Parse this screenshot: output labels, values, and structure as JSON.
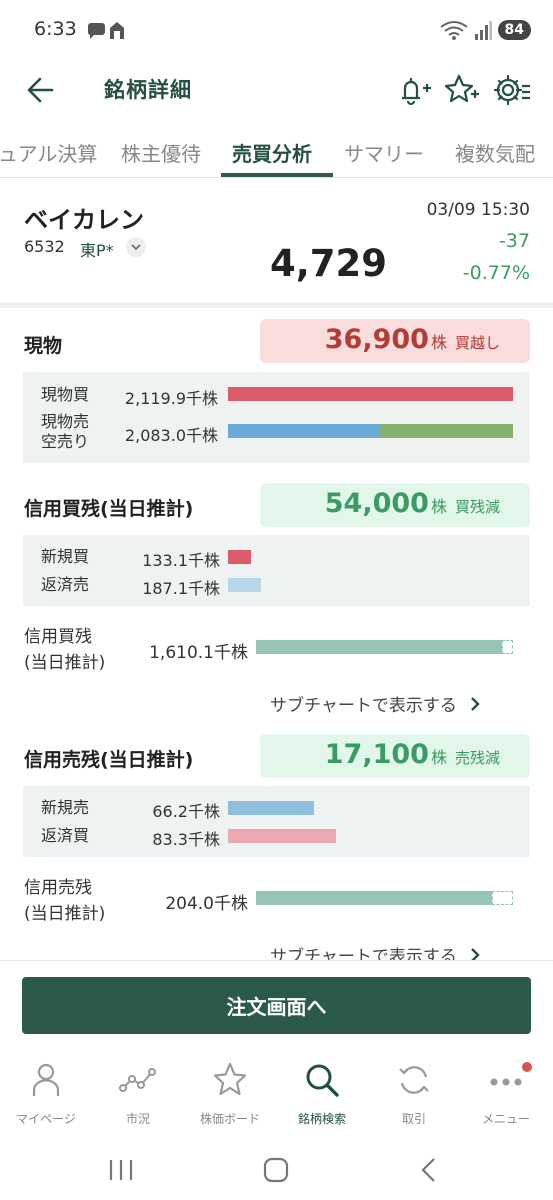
{
  "status": {
    "time": "6:33",
    "battery": "84"
  },
  "appbar": {
    "title": "銘柄詳細"
  },
  "tabs": [
    {
      "label": "ュアル決算"
    },
    {
      "label": "株主優待"
    },
    {
      "label": "売買分析"
    },
    {
      "label": "サマリー"
    },
    {
      "label": "複数気配"
    }
  ],
  "stock": {
    "name": "ベイカレン",
    "code": "6532",
    "market": "東P*",
    "price": "4,729",
    "datetime": "03/09 15:30",
    "change": "-37",
    "change_pct": "-0.77%"
  },
  "genbutsu": {
    "title": "現物",
    "pill_value": "36,900",
    "pill_unit": "株",
    "pill_label": "買越し",
    "buy_label": "現物買",
    "buy_value": "2,119.9千株",
    "sell_label_1": "現物売",
    "sell_label_2": "空売り",
    "sell_value": "2,083.0千株"
  },
  "margin_buy": {
    "title": "信用買残(当日推計)",
    "pill_value": "54,000",
    "pill_unit": "株",
    "pill_label": "買残減",
    "new_label": "新規買",
    "new_value": "133.1千株",
    "repay_label": "返済売",
    "repay_value": "187.1千株",
    "balance_label_1": "信用買残",
    "balance_label_2": "(当日推計)",
    "balance_value": "1,610.1千株",
    "subchart_link": "サブチャートで表示する"
  },
  "margin_sell": {
    "title": "信用売残(当日推計)",
    "pill_value": "17,100",
    "pill_unit": "株",
    "pill_label": "売残減",
    "new_label": "新規売",
    "new_value": "66.2千株",
    "repay_label": "返済買",
    "repay_value": "83.3千株",
    "balance_label_1": "信用売残",
    "balance_label_2": "(当日推計)",
    "balance_value": "204.0千株",
    "subchart_link": "サブチャートで表示する"
  },
  "order_button": "注文画面へ",
  "bottom_nav": [
    {
      "label": "マイページ",
      "icon": "person-icon"
    },
    {
      "label": "市況",
      "icon": "market-chart-icon"
    },
    {
      "label": "株価ボード",
      "icon": "star-icon"
    },
    {
      "label": "銘柄検索",
      "icon": "search-icon"
    },
    {
      "label": "取引",
      "icon": "refresh-icon"
    },
    {
      "label": "メニュー",
      "icon": "more-icon"
    }
  ],
  "colors": {
    "brand_green": "#2b5a4b",
    "buy_red": "#db5d6a",
    "sell_blue": "#6aa9d8",
    "short_green": "#86b06e",
    "balance_teal": "#96c4b5",
    "up_green": "#3a9b63"
  }
}
